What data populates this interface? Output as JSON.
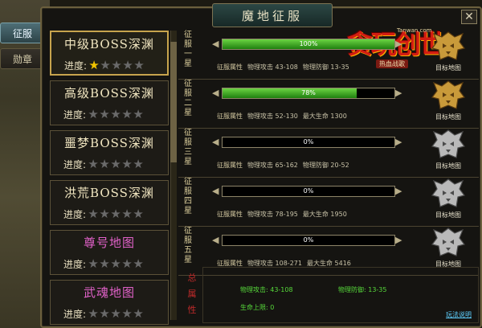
{
  "side_tabs": [
    {
      "label": "征服",
      "active": true
    },
    {
      "label": "勋章",
      "active": false
    }
  ],
  "window": {
    "title": "魔地征服",
    "close_label": "✕",
    "logo": {
      "site": "Tanwan.com",
      "text": "贪玩创世",
      "sub": "热血战歌"
    }
  },
  "maps": [
    {
      "name": "中级BOSS深渊",
      "progress_label": "进度:",
      "stars_lit": 1,
      "stars_total": 5,
      "selected": true,
      "color": "#f1e6c0"
    },
    {
      "name": "高级BOSS深渊",
      "progress_label": "进度:",
      "stars_lit": 0,
      "stars_total": 5,
      "selected": false,
      "color": "#f1e6c0"
    },
    {
      "name": "噩梦BOSS深渊",
      "progress_label": "进度:",
      "stars_lit": 0,
      "stars_total": 5,
      "selected": false,
      "color": "#f1e6c0"
    },
    {
      "name": "洪荒BOSS深渊",
      "progress_label": "进度:",
      "stars_lit": 0,
      "stars_total": 5,
      "selected": false,
      "color": "#f1e6c0"
    },
    {
      "name": "尊号地图",
      "progress_label": "进度:",
      "stars_lit": 0,
      "stars_total": 5,
      "selected": false,
      "color": "#e061c8"
    },
    {
      "name": "武魂地图",
      "progress_label": "进度:",
      "stars_lit": 0,
      "stars_total": 5,
      "selected": false,
      "color": "#e061c8"
    }
  ],
  "stages": [
    {
      "label": "征服一星",
      "progress": 100,
      "progress_text": "100%",
      "attr_key": "征服属性",
      "attrs": [
        "物理攻击 43-108",
        "物理防御 13-35"
      ],
      "target_label": "目标地图",
      "target_color": "gold"
    },
    {
      "label": "征服二星",
      "progress": 78,
      "progress_text": "78%",
      "attr_key": "征服属性",
      "attrs": [
        "物理攻击 52-130",
        "最大生命 1300"
      ],
      "target_label": "目标地图",
      "target_color": "gold"
    },
    {
      "label": "征服三星",
      "progress": 0,
      "progress_text": "0%",
      "attr_key": "征服属性",
      "attrs": [
        "物理攻击 65-162",
        "物理防御 20-52"
      ],
      "target_label": "目标地图",
      "target_color": "silver"
    },
    {
      "label": "征服四星",
      "progress": 0,
      "progress_text": "0%",
      "attr_key": "征服属性",
      "attrs": [
        "物理攻击 78-195",
        "最大生命 1950"
      ],
      "target_label": "目标地图",
      "target_color": "silver"
    },
    {
      "label": "征服五星",
      "progress": 0,
      "progress_text": "0%",
      "attr_key": "征服属性",
      "attrs": [
        "物理攻击 108-271",
        "最大生命 5416"
      ],
      "target_label": "目标地图",
      "target_color": "silver"
    }
  ],
  "summary": {
    "label": "总属性",
    "attack": "物理攻击: 43-108",
    "defense": "物理防御: 13-35",
    "hp": "生命上限: 0",
    "help_link": "玩法说明"
  }
}
